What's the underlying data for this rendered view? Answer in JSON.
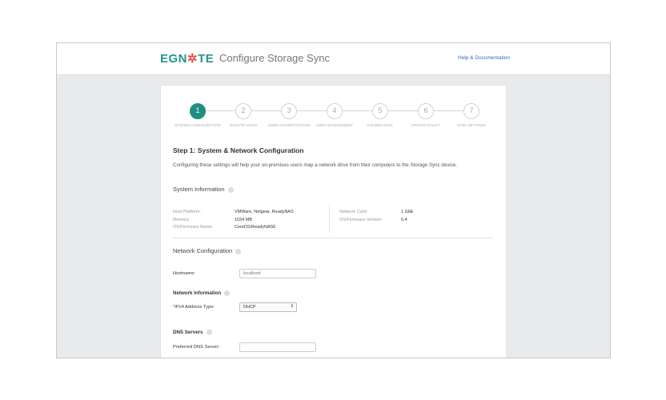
{
  "header": {
    "logo": "EGNYTE",
    "title": "Configure Storage Sync",
    "help_link": "Help & Documentation",
    "brand_color": "#1f8f84"
  },
  "steps": [
    {
      "number": "1",
      "label": "SYSTEM CONFIGURATION",
      "active": true
    },
    {
      "number": "2",
      "label": "EGNYTE LOGIN"
    },
    {
      "number": "3",
      "label": "USER AUTHENTICATION"
    },
    {
      "number": "4",
      "label": "USER MANAGEMENT"
    },
    {
      "number": "5",
      "label": "FOLDER SYNC"
    },
    {
      "number": "6",
      "label": "UPDATE POLICY"
    },
    {
      "number": "7",
      "label": "SYNC SETTINGS"
    }
  ],
  "main": {
    "heading": "Step 1: System & Network Configuration",
    "description": "Configuring these settings will help your on-premises users map a network drive from their computers to the Storage Sync device.",
    "system_info": {
      "title": "System Information",
      "left": [
        {
          "k": "Host Platform:",
          "v": "VMWare, Netgear, ReadyNAS"
        },
        {
          "k": "Memory:",
          "v": "1024 MB"
        },
        {
          "k": "OS/Firmware Name:",
          "v": "CentOS/ReadyNAS6"
        }
      ],
      "right": [
        {
          "k": "Network Card:",
          "v": "1 GbE"
        },
        {
          "k": "OS/Firmware Version:",
          "v": "6.4"
        }
      ]
    },
    "network": {
      "title": "Network Configuration",
      "hostname_label": "Hostname:",
      "hostname_placeholder": "localhost",
      "network_info_title": "Network Information",
      "ipv4_required": "*",
      "ipv4_label": "IPv4 Address Type:",
      "ipv4_value": "DHCP",
      "dns_title": "DNS Servers",
      "preferred_dns_label": "Preferred DNS Server:",
      "preferred_dns_value": ""
    }
  }
}
